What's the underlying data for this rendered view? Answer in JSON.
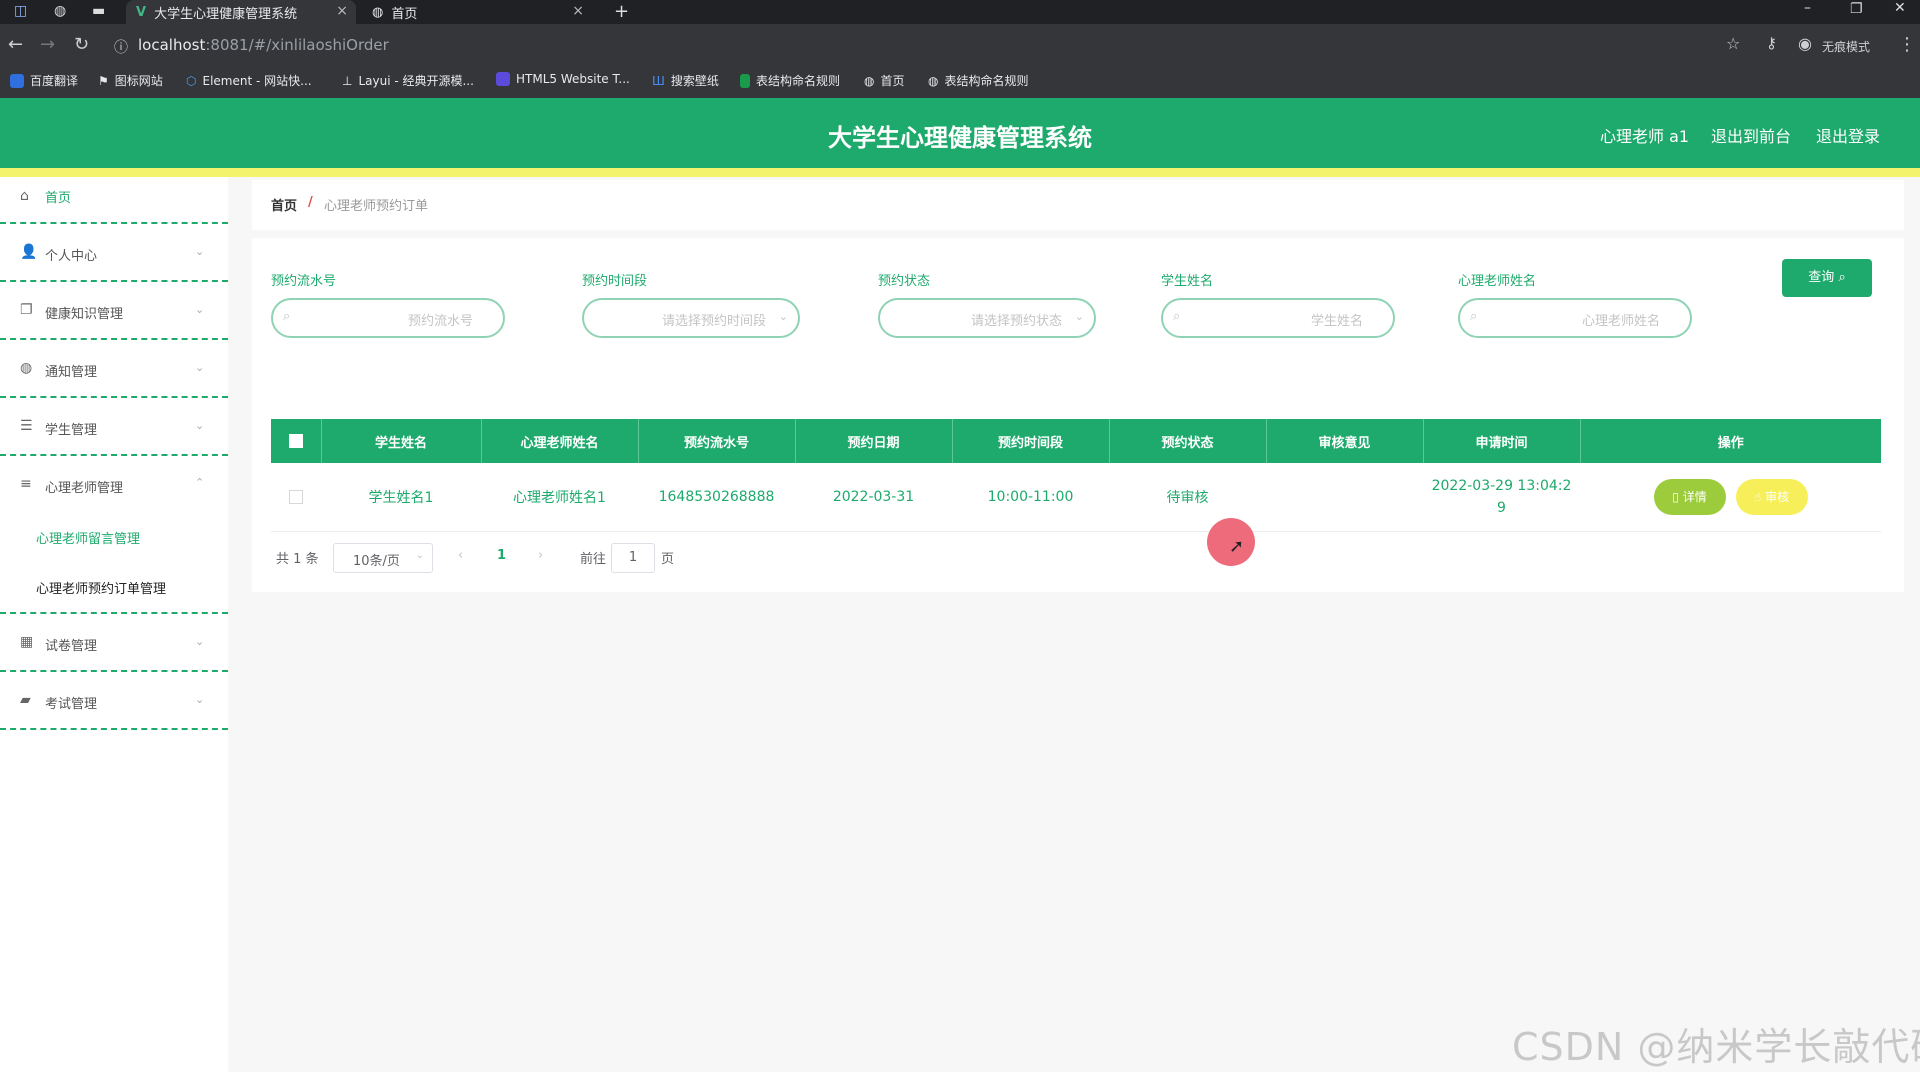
{
  "browser": {
    "tabs": [
      {
        "title": "大学生心理健康管理系统",
        "active": true
      },
      {
        "title": "首页",
        "active": false
      }
    ],
    "url_host": "localhost",
    "url_rest": ":8081/#/xinlilaoshiOrder",
    "profile_label": "无痕模式",
    "bookmarks": [
      "百度翻译",
      "图标网站",
      "Element - 网站快...",
      "Layui - 经典开源模...",
      "HTML5 Website T...",
      "搜索壁纸",
      "表结构命名规则",
      "首页",
      "表结构命名规则"
    ]
  },
  "header": {
    "title": "大学生心理健康管理系统",
    "user_label": "心理老师 a1",
    "front_link": "退出到前台",
    "logout_link": "退出登录"
  },
  "sidebar": {
    "items": [
      {
        "label": "首页",
        "icon": "home-icon"
      },
      {
        "label": "个人中心",
        "icon": "user-icon"
      },
      {
        "label": "健康知识管理",
        "icon": "copy-icon"
      },
      {
        "label": "通知管理",
        "icon": "globe-icon"
      },
      {
        "label": "学生管理",
        "icon": "sliders-icon"
      },
      {
        "label": "心理老师管理",
        "icon": "list-icon"
      },
      {
        "label": "试卷管理",
        "icon": "grid-icon"
      },
      {
        "label": "考试管理",
        "icon": "briefcase-icon"
      }
    ],
    "sub_items": [
      "心理老师留言管理",
      "心理老师预约订单管理"
    ]
  },
  "breadcrumb": {
    "home": "首页",
    "separator": "/",
    "current": "心理老师预约订单"
  },
  "filters": [
    {
      "label": "预约流水号",
      "placeholder": "预约流水号",
      "type": "search"
    },
    {
      "label": "预约时间段",
      "placeholder": "请选择预约时间段",
      "type": "select"
    },
    {
      "label": "预约状态",
      "placeholder": "请选择预约状态",
      "type": "select"
    },
    {
      "label": "学生姓名",
      "placeholder": "学生姓名",
      "type": "search"
    },
    {
      "label": "心理老师姓名",
      "placeholder": "心理老师姓名",
      "type": "search"
    }
  ],
  "query_button": "查询",
  "table": {
    "headers": [
      "学生姓名",
      "心理老师姓名",
      "预约流水号",
      "预约日期",
      "预约时间段",
      "预约状态",
      "审核意见",
      "申请时间",
      "操作"
    ],
    "rows": [
      {
        "student": "学生姓名1",
        "teacher": "心理老师姓名1",
        "serial": "1648530268888",
        "date": "2022-03-31",
        "slot": "10:00-11:00",
        "status": "待审核",
        "opinion": "",
        "apply_time_1": "2022-03-29 13:04:2",
        "apply_time_2": "9",
        "detail_btn": "详情",
        "audit_btn": "审核"
      }
    ]
  },
  "pagination": {
    "total": "共 1 条",
    "page_size": "10条/页",
    "current": "1",
    "goto_label": "前往",
    "goto_value": "1",
    "page_unit": "页"
  },
  "watermark": "CSDN @纳米学长敲代码",
  "colors": {
    "primary": "#1eaa6c",
    "accent_bar": "#f3f36e",
    "detail": "#9ccc3c",
    "audit": "#f6ef5a"
  }
}
